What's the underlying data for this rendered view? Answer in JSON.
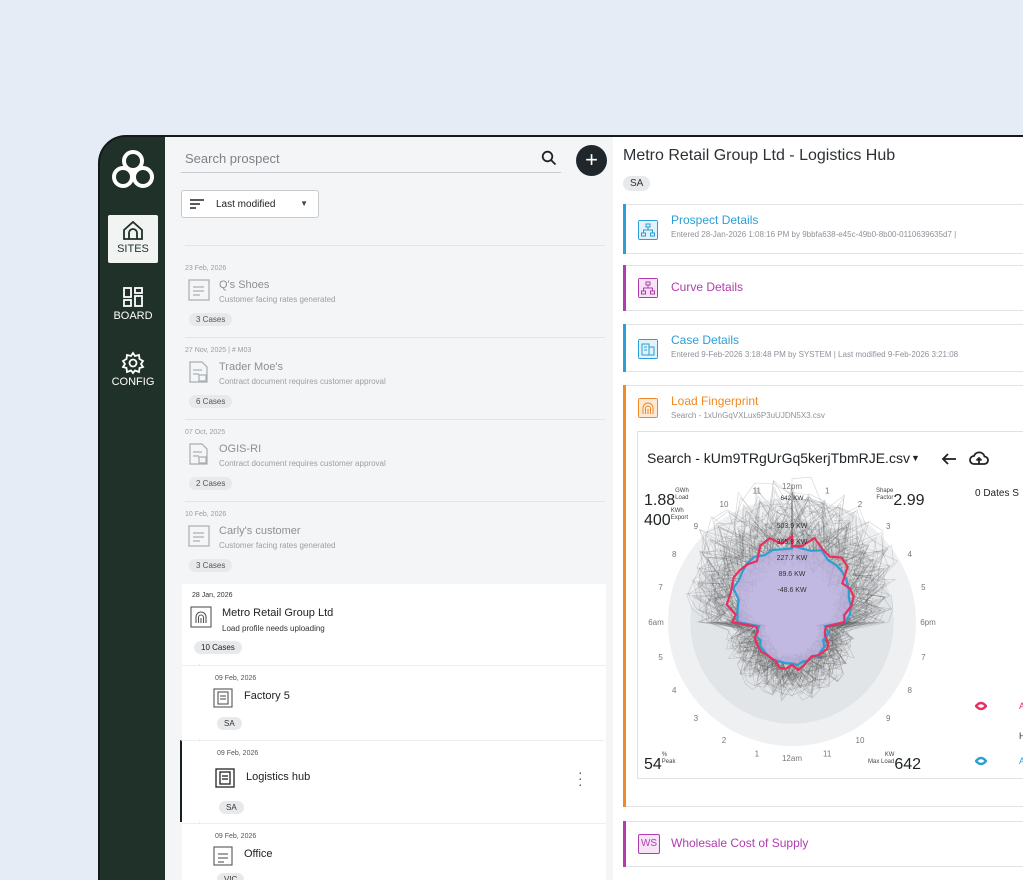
{
  "nav": {
    "items": [
      {
        "label": "SITES",
        "icon": "sites-icon",
        "active": true
      },
      {
        "label": "BOARD",
        "icon": "board-icon",
        "active": false
      },
      {
        "label": "CONFIG",
        "icon": "config-icon",
        "active": false
      }
    ]
  },
  "list": {
    "search_placeholder": "Search prospect",
    "sort_label": "Last modified",
    "items": [
      {
        "date": "23 Feb, 2026",
        "name": "Q's Shoes",
        "status": "Customer facing rates generated",
        "cases": "3 Cases"
      },
      {
        "date": "27 Nov, 2025  |  # M03",
        "name": "Trader Moe's",
        "status": "Contract document requires customer approval",
        "cases": "6 Cases"
      },
      {
        "date": "07 Oct, 2025",
        "name": "OGIS-RI",
        "status": "Contract document requires customer approval",
        "cases": "2 Cases"
      },
      {
        "date": "10 Feb, 2026",
        "name": "Carly's customer",
        "status": "Customer facing rates generated",
        "cases": "3 Cases"
      }
    ],
    "selected": {
      "date": "28 Jan, 2026",
      "name": "Metro Retail Group Ltd",
      "status": "Load profile needs uploading",
      "cases": "10 Cases",
      "children": [
        {
          "date": "09 Feb, 2026",
          "name": "Factory 5",
          "state": "SA"
        },
        {
          "date": "09 Feb, 2026",
          "name": "Logistics hub",
          "state": "SA"
        },
        {
          "date": "09 Feb, 2026",
          "name": "Office",
          "state": "VIC"
        }
      ]
    }
  },
  "detail": {
    "title": "Metro Retail Group Ltd - Logistics Hub",
    "state": "SA",
    "cards": {
      "prospect": {
        "title": "Prospect Details",
        "meta": "Entered 28-Jan-2026 1:08:16 PM by 9bbfa638-e45c-49b0-8b00-0110639635d7  |"
      },
      "curve": {
        "title": "Curve Details"
      },
      "case": {
        "title": "Case Details",
        "meta": "Entered 9-Feb-2026 3:18:48 PM by SYSTEM   |   Last modified 9-Feb-2026 3:21:08"
      },
      "load": {
        "title": "Load Fingerprint",
        "meta": "Search - 1xUnGqVXLux6P3uUJDN5X3.csv"
      },
      "wholesale": {
        "title": "Wholesale Cost of Supply",
        "icon_text": "WS"
      }
    },
    "fingerprint": {
      "file_title": "Search - kUm9TRgUrGq5kerjTbmRJE.csv",
      "load_value": "1.88",
      "load_unit": "GWh",
      "load_label": "Load",
      "export_value": "400",
      "export_unit": "KWh",
      "export_label": "Export",
      "shape_label_1": "Shape",
      "shape_label_2": "Factor",
      "shape_value": "2.99",
      "dates_text": "0 Dates S",
      "peak_value": "54",
      "peak_unit": "%",
      "peak_label": "Peak",
      "maxload_unit": "KW",
      "maxload_label": "Max Load",
      "maxload_value": "642",
      "ring_labels": [
        "642 KW",
        "503.9 KW",
        "365.8 KW",
        "227.7 KW",
        "89.6 KW",
        "-48.6 KW"
      ],
      "hour_labels": [
        "12pm",
        "1",
        "2",
        "3",
        "4",
        "5",
        "6pm",
        "7",
        "8",
        "9",
        "10",
        "11",
        "12am",
        "1",
        "2",
        "3",
        "4",
        "5",
        "6am",
        "7",
        "8",
        "9",
        "10",
        "11"
      ],
      "legend_letters": [
        "A",
        "H",
        "A"
      ]
    },
    "colors": {
      "prospect": "#2b9fd6",
      "curve": "#b23cae",
      "case": "#2b9fd6",
      "load": "#ef8a26",
      "wholesale": "#b23cae"
    }
  }
}
